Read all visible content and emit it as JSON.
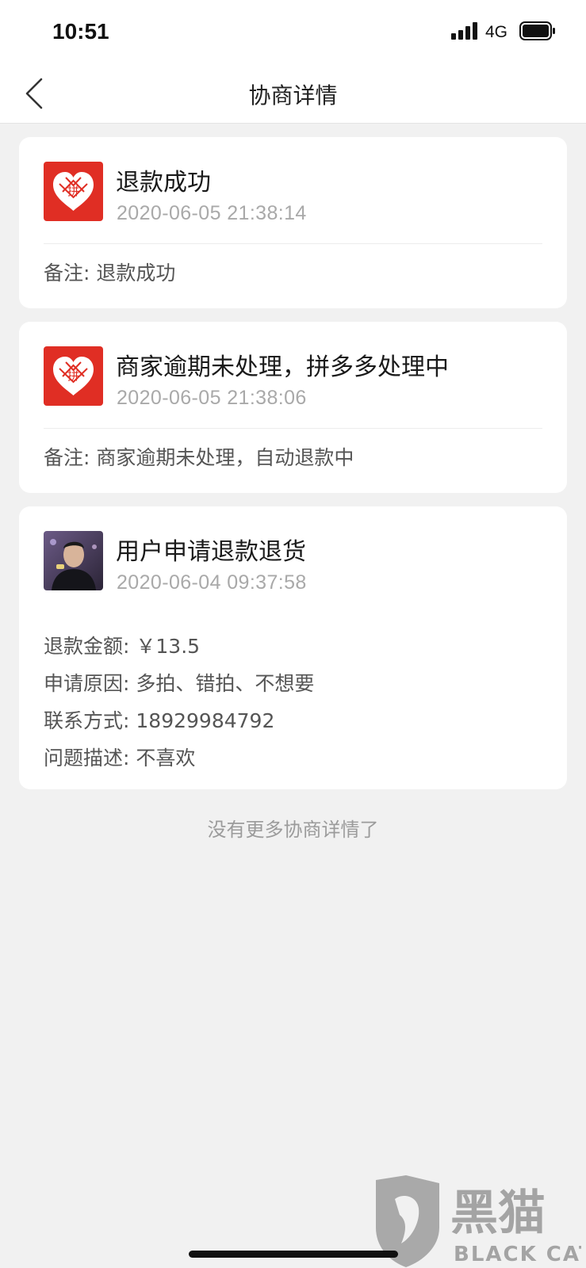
{
  "status_bar": {
    "time": "10:51",
    "network": "4G"
  },
  "nav": {
    "title": "协商详情"
  },
  "events": [
    {
      "avatar": "pinduoduo-logo",
      "title": "退款成功",
      "time": "2020-06-05 21:38:14",
      "remark_label": "备注:",
      "remark_value": "退款成功"
    },
    {
      "avatar": "pinduoduo-logo",
      "title": "商家逾期未处理，拼多多处理中",
      "time": "2020-06-05 21:38:06",
      "remark_label": "备注:",
      "remark_value": "商家逾期未处理，自动退款中"
    },
    {
      "avatar": "user-photo",
      "title": "用户申请退款退货",
      "time": "2020-06-04 09:37:58",
      "details": [
        {
          "label": "退款金额:",
          "value": "￥13.5"
        },
        {
          "label": "申请原因:",
          "value": "多拍、错拍、不想要"
        },
        {
          "label": "联系方式:",
          "value": "18929984792"
        },
        {
          "label": "问题描述:",
          "value": "不喜欢"
        }
      ]
    }
  ],
  "footer": {
    "text": "没有更多协商详情了"
  },
  "watermark": {
    "cn": "黑猫",
    "en": "BLACK CAT"
  },
  "colors": {
    "brand_red": "#e02e24",
    "background": "#f1f1f1"
  }
}
